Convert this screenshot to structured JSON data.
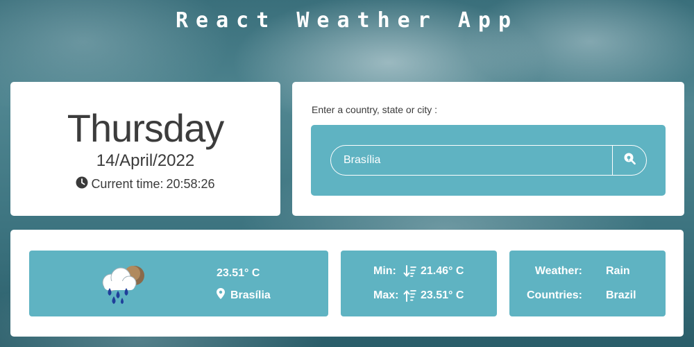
{
  "app": {
    "title": "React Weather App"
  },
  "date_card": {
    "day": "Thursday",
    "date": "14/April/2022",
    "time_label": "Current time:",
    "time_value": "20:58:26"
  },
  "search": {
    "label": "Enter a country, state or city :",
    "value": "Brasília",
    "placeholder": ""
  },
  "current": {
    "temperature": "23.51° C",
    "city": "Brasília",
    "icon": "rain-cloud-icon"
  },
  "minmax": {
    "min_label": "Min:",
    "min_value": "21.46° C",
    "max_label": "Max:",
    "max_value": "23.51° C"
  },
  "details": {
    "weather_label": "Weather:",
    "weather_value": "Rain",
    "countries_label": "Countries:",
    "countries_value": "Brazil"
  },
  "colors": {
    "accent": "#5fb3c2",
    "card": "#ffffff",
    "text_dark": "#3c3c3c"
  }
}
